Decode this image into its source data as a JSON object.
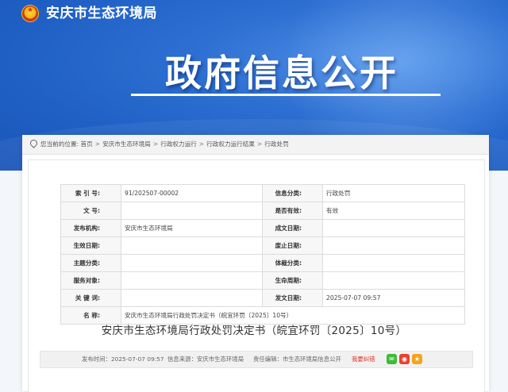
{
  "header": {
    "site_title": "安庆市生态环境局",
    "emblem_icon": "national-emblem-icon",
    "banner_title": "政府信息公开",
    "brand_color": "#2d6fd2"
  },
  "breadcrumb": {
    "prefix": "您当前的位置:",
    "items": [
      "首页",
      "安庆市生态环境局",
      "行政权力运行",
      "行政权力运行结果",
      "行政处罚"
    ],
    "separator": ">"
  },
  "meta_table": {
    "rows": [
      {
        "l1": "索 引 号:",
        "v1": "91/202507-00002",
        "l2": "信息分类:",
        "v2": "行政处罚"
      },
      {
        "l1": "文 号:",
        "v1": "",
        "l2": "是否有效:",
        "v2": "有效"
      },
      {
        "l1": "发布机构:",
        "v1": "安庆市生态环境局",
        "l2": "成文日期:",
        "v2": ""
      },
      {
        "l1": "生效日期:",
        "v1": "",
        "l2": "废止日期:",
        "v2": ""
      },
      {
        "l1": "主题分类:",
        "v1": "",
        "l2": "体裁分类:",
        "v2": ""
      },
      {
        "l1": "服务对象:",
        "v1": "",
        "l2": "生命周期:",
        "v2": ""
      },
      {
        "l1": "关 键 词:",
        "v1": "",
        "l2": "发文日期:",
        "v2": "2025-07-07 09:57"
      }
    ],
    "name_label": "名 称:",
    "name_value": "安庆市生态环境局行政处罚决定书（皖宜环罚〔2025〕10号）"
  },
  "document": {
    "title": "安庆市生态环境局行政处罚决定书（皖宜环罚〔2025〕10号）"
  },
  "info_bar": {
    "publish_time": "发布时间：2025-07-07 09:57",
    "source": "信息来源：安庆市生态环境局",
    "editor": "责任编辑：市生态环境局信息公开",
    "error_link": "我要纠错",
    "share_icons": [
      "wechat-icon",
      "weibo-icon",
      "qzone-icon"
    ],
    "share_colors": [
      "#3dbb3b",
      "#e6432e",
      "#f2a51c"
    ]
  }
}
